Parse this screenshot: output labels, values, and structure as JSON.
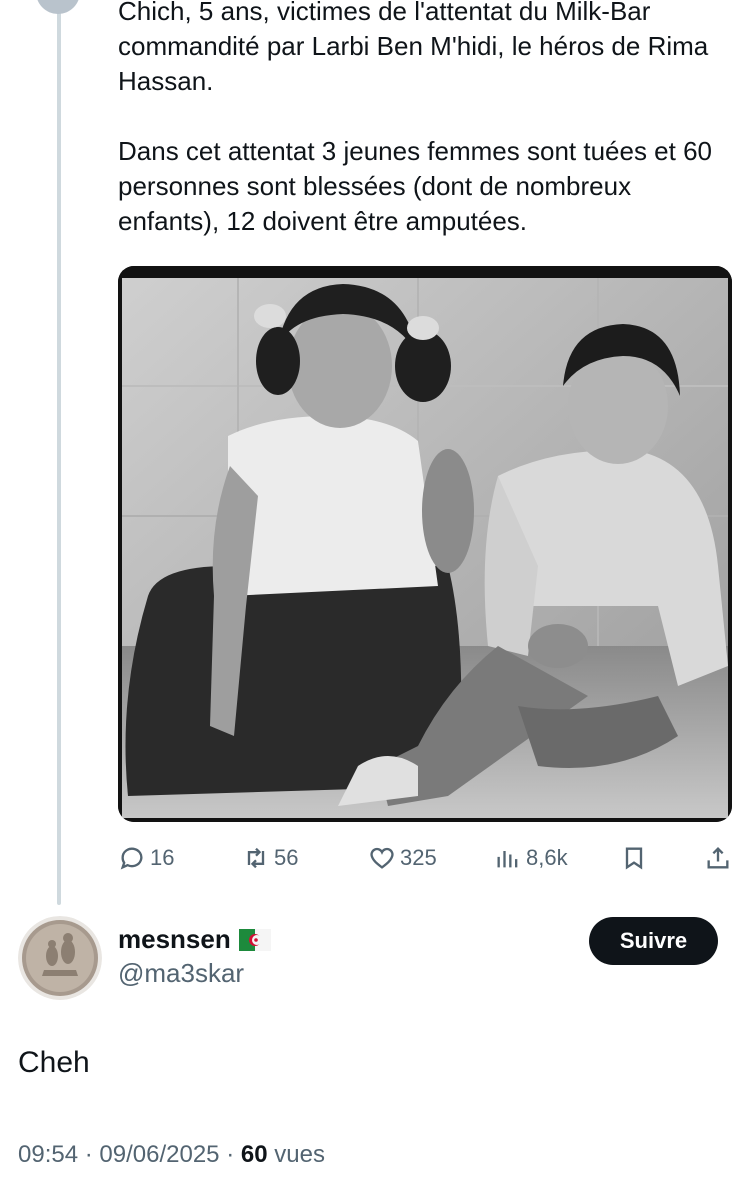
{
  "tweet": {
    "paragraph1": "Chich, 5 ans, victimes de l'attentat du Milk-Bar commandité par Larbi Ben M'hidi, le héros de Rima Hassan.",
    "paragraph2": "Dans cet attentat 3 jeunes femmes sont tuées et 60 personnes sont blessées (dont de nombreux enfants), 12 doivent être amputées.",
    "stats": {
      "replies": "16",
      "retweets": "56",
      "likes": "325",
      "views": "8,6k"
    }
  },
  "reply": {
    "display_name": "mesnsen",
    "handle": "@ma3skar",
    "follow_label": "Suivre",
    "text": "Cheh",
    "time": "09:54",
    "date": "09/06/2025",
    "views_count": "60",
    "views_label": "vues",
    "separator": "·"
  },
  "icons": {
    "reply": "reply-icon",
    "retweet": "retweet-icon",
    "like": "heart-icon",
    "views": "views-icon",
    "bookmark": "bookmark-icon",
    "share": "share-icon",
    "flag": "algeria-flag-icon"
  },
  "colors": {
    "text": "#0f1419",
    "secondary": "#536471",
    "thread_line": "#cfd9de",
    "button": "#0f1419"
  }
}
